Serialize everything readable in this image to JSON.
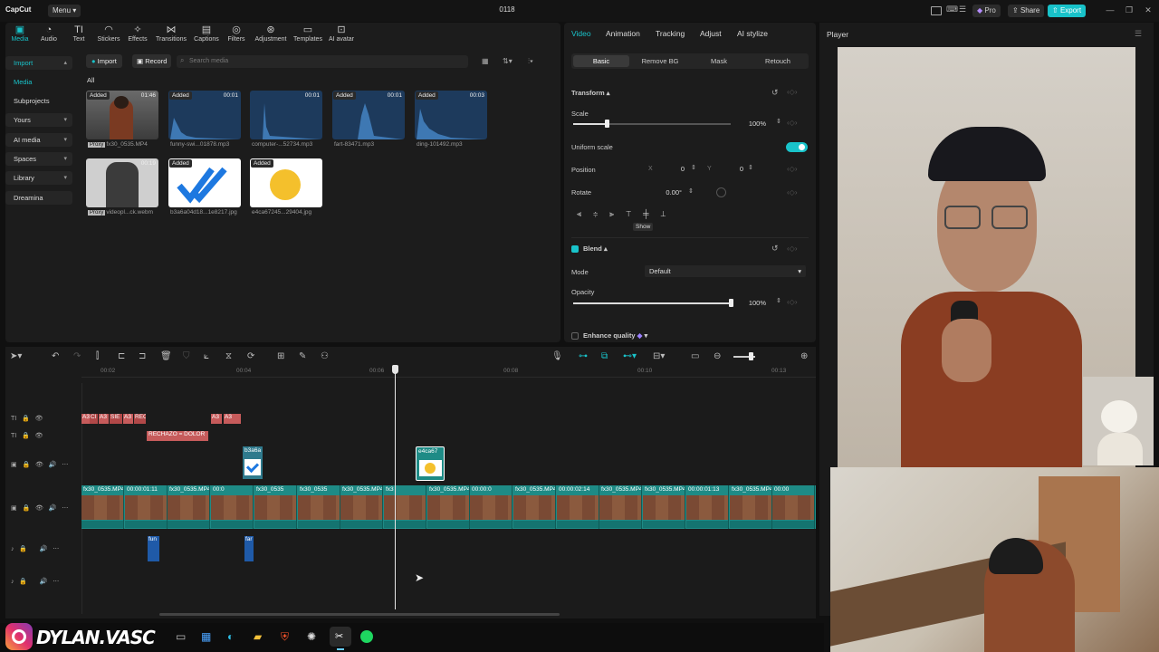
{
  "app": {
    "logo": "CapCut",
    "menu_label": "Menu",
    "title": "0118",
    "pro_label": "Pro",
    "share_label": "Share",
    "export_label": "Export",
    "player_label": "Player"
  },
  "toolbar": [
    {
      "label": "Media",
      "icon": "media-icon"
    },
    {
      "label": "Audio",
      "icon": "audio-icon"
    },
    {
      "label": "Text",
      "icon": "text-icon"
    },
    {
      "label": "Stickers",
      "icon": "stickers-icon"
    },
    {
      "label": "Effects",
      "icon": "effects-icon"
    },
    {
      "label": "Transitions",
      "icon": "transitions-icon"
    },
    {
      "label": "Captions",
      "icon": "captions-icon"
    },
    {
      "label": "Filters",
      "icon": "filters-icon"
    },
    {
      "label": "Adjustment",
      "icon": "adjustment-icon"
    },
    {
      "label": "Templates",
      "icon": "templates-icon"
    },
    {
      "label": "AI avatar",
      "icon": "ai-avatar-icon"
    }
  ],
  "sidebar": [
    {
      "label": "Import"
    },
    {
      "label": "Media"
    },
    {
      "label": "Subprojects"
    },
    {
      "label": "Yours"
    },
    {
      "label": "AI media"
    },
    {
      "label": "Spaces"
    },
    {
      "label": "Library"
    },
    {
      "label": "Dreamina"
    }
  ],
  "media": {
    "import_label": "Import",
    "record_label": "Record",
    "search_placeholder": "Search media",
    "filter_all": "All",
    "items": [
      {
        "name": "fx30_0535.MP4",
        "badge": "Added",
        "duration": "01:46",
        "proxy": "Proxy"
      },
      {
        "name": "funny-swi...01878.mp3",
        "badge": "Added",
        "duration": "00:01"
      },
      {
        "name": "computer-...52734.mp3",
        "badge": "",
        "duration": "00:01"
      },
      {
        "name": "fart-83471.mp3",
        "badge": "Added",
        "duration": "00:01"
      },
      {
        "name": "ding-101492.mp3",
        "badge": "Added",
        "duration": "00:03"
      },
      {
        "name": "videopl...ck.webm",
        "badge": "",
        "duration": "00:19",
        "proxy": "Proxy"
      },
      {
        "name": "b3a6a04d18...1e8217.jpg",
        "badge": "Added",
        "duration": ""
      },
      {
        "name": "e4ca67245...29404.jpg",
        "badge": "Added",
        "duration": ""
      }
    ]
  },
  "props": {
    "tabs": [
      "Video",
      "Animation",
      "Tracking",
      "Adjust",
      "AI stylize"
    ],
    "subtabs": [
      "Basic",
      "Remove BG",
      "Mask",
      "Retouch"
    ],
    "transform_label": "Transform",
    "scale_label": "Scale",
    "scale_value": "100%",
    "uniform_scale_label": "Uniform scale",
    "position_label": "Position",
    "pos_x_label": "X",
    "pos_x": "0",
    "pos_y_label": "Y",
    "pos_y": "0",
    "rotate_label": "Rotate",
    "rotate_value": "0.00°",
    "tooltip": "Show",
    "blend_label": "Blend",
    "mode_label": "Mode",
    "mode_value": "Default",
    "opacity_label": "Opacity",
    "opacity_value": "100%",
    "enhance_label": "Enhance quality",
    "scale_fraction": 0.21,
    "opacity_fraction": 1.0
  },
  "timeline": {
    "ruler": [
      "00:02",
      "00:04",
      "00:06",
      "00:08",
      "00:10",
      "00:13"
    ],
    "text_clips": [
      "A3",
      "Cl",
      "A3",
      "SIE",
      "A3",
      "REC",
      "A3",
      "A3"
    ],
    "rechazo_label": "RECHAZO = DOLOR",
    "overlay_clips": [
      "b3a6a",
      "e4ca67"
    ],
    "main_clip_labels": [
      "fx30_0535.MP4",
      "00:00:01:11",
      "fx30_0535.MP4",
      "00:0",
      "fx30_0535",
      "fx30_0535",
      "fx30_0535.MP4",
      "fx3",
      "fx30_0535.MP4",
      "00:00:0",
      "fx30_0535.MP4",
      "00:00:02:14",
      "fx30_0535.MP4",
      "fx30_0535.MP4",
      "00:00:01:13",
      "fx30_0535.MP4",
      "00:00"
    ],
    "audio_clips": [
      "fun",
      "far"
    ]
  },
  "overlay": {
    "watermark": "DYLAN.VASC"
  },
  "colors": {
    "accent": "#19c3ca",
    "text_clip": "#c65b5b",
    "main_track": "#1e8b86",
    "audio": "#1f5aa8"
  }
}
